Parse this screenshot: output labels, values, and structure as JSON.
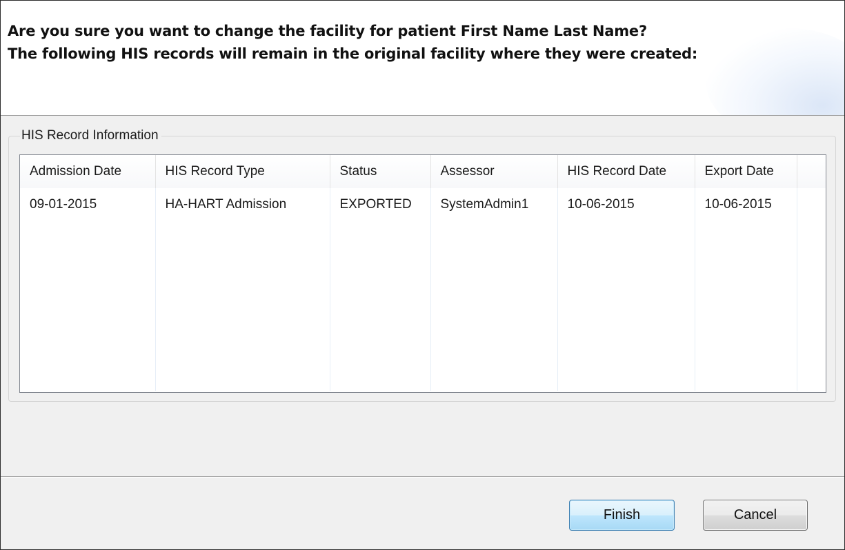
{
  "header": {
    "line1": "Are you sure you want to change the facility for patient First Name Last Name?",
    "line2": "The following HIS records will remain in the original facility where they were created:"
  },
  "group": {
    "label": "HIS Record Information"
  },
  "table": {
    "columns": [
      "Admission Date",
      "HIS Record Type",
      "Status",
      "Assessor",
      "HIS Record Date",
      "Export Date"
    ],
    "rows": [
      [
        "09-01-2015",
        "HA-HART Admission",
        "EXPORTED",
        "SystemAdmin1",
        "10-06-2015",
        "10-06-2015"
      ]
    ]
  },
  "buttons": {
    "finish": "Finish",
    "cancel": "Cancel"
  }
}
